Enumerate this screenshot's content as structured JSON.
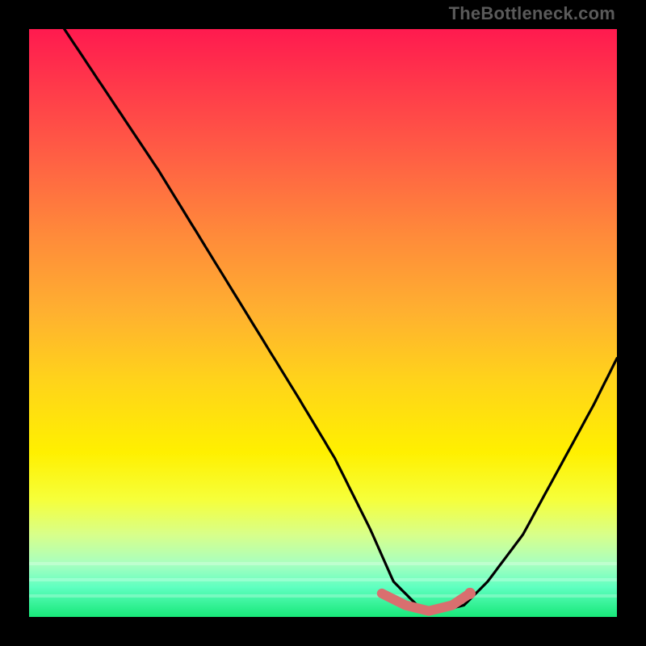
{
  "watermark": "TheBottleneck.com",
  "chart_data": {
    "type": "line",
    "title": "",
    "xlabel": "",
    "ylabel": "",
    "xlim": [
      0,
      100
    ],
    "ylim": [
      0,
      100
    ],
    "grid": false,
    "legend": false,
    "description": "Bottleneck-style V curve overlaid on vertical heat gradient (red=high mismatch, green=optimal). The curve drops from top-left, flattens near the bottom around x≈62-74, then rises toward the right edge. A short salmon segment marks the flat optimal region.",
    "series": [
      {
        "name": "bottleneck-curve",
        "color": "#000000",
        "x": [
          6,
          14,
          22,
          30,
          38,
          46,
          52,
          58,
          62,
          66,
          70,
          74,
          78,
          84,
          90,
          96,
          100
        ],
        "y": [
          100,
          88,
          76,
          63,
          50,
          37,
          27,
          15,
          6,
          2,
          1,
          2,
          6,
          14,
          25,
          36,
          44
        ]
      },
      {
        "name": "optimal-marker",
        "color": "#d96f6f",
        "x": [
          60,
          64,
          68,
          72,
          75
        ],
        "y": [
          4,
          2,
          1,
          2,
          4
        ]
      }
    ],
    "gradient_stops": [
      {
        "pos": 0,
        "color": "#ff1a4f"
      },
      {
        "pos": 22,
        "color": "#ff6044"
      },
      {
        "pos": 48,
        "color": "#ffb030"
      },
      {
        "pos": 72,
        "color": "#fff000"
      },
      {
        "pos": 91,
        "color": "#a8ffc0"
      },
      {
        "pos": 100,
        "color": "#18e879"
      }
    ]
  }
}
